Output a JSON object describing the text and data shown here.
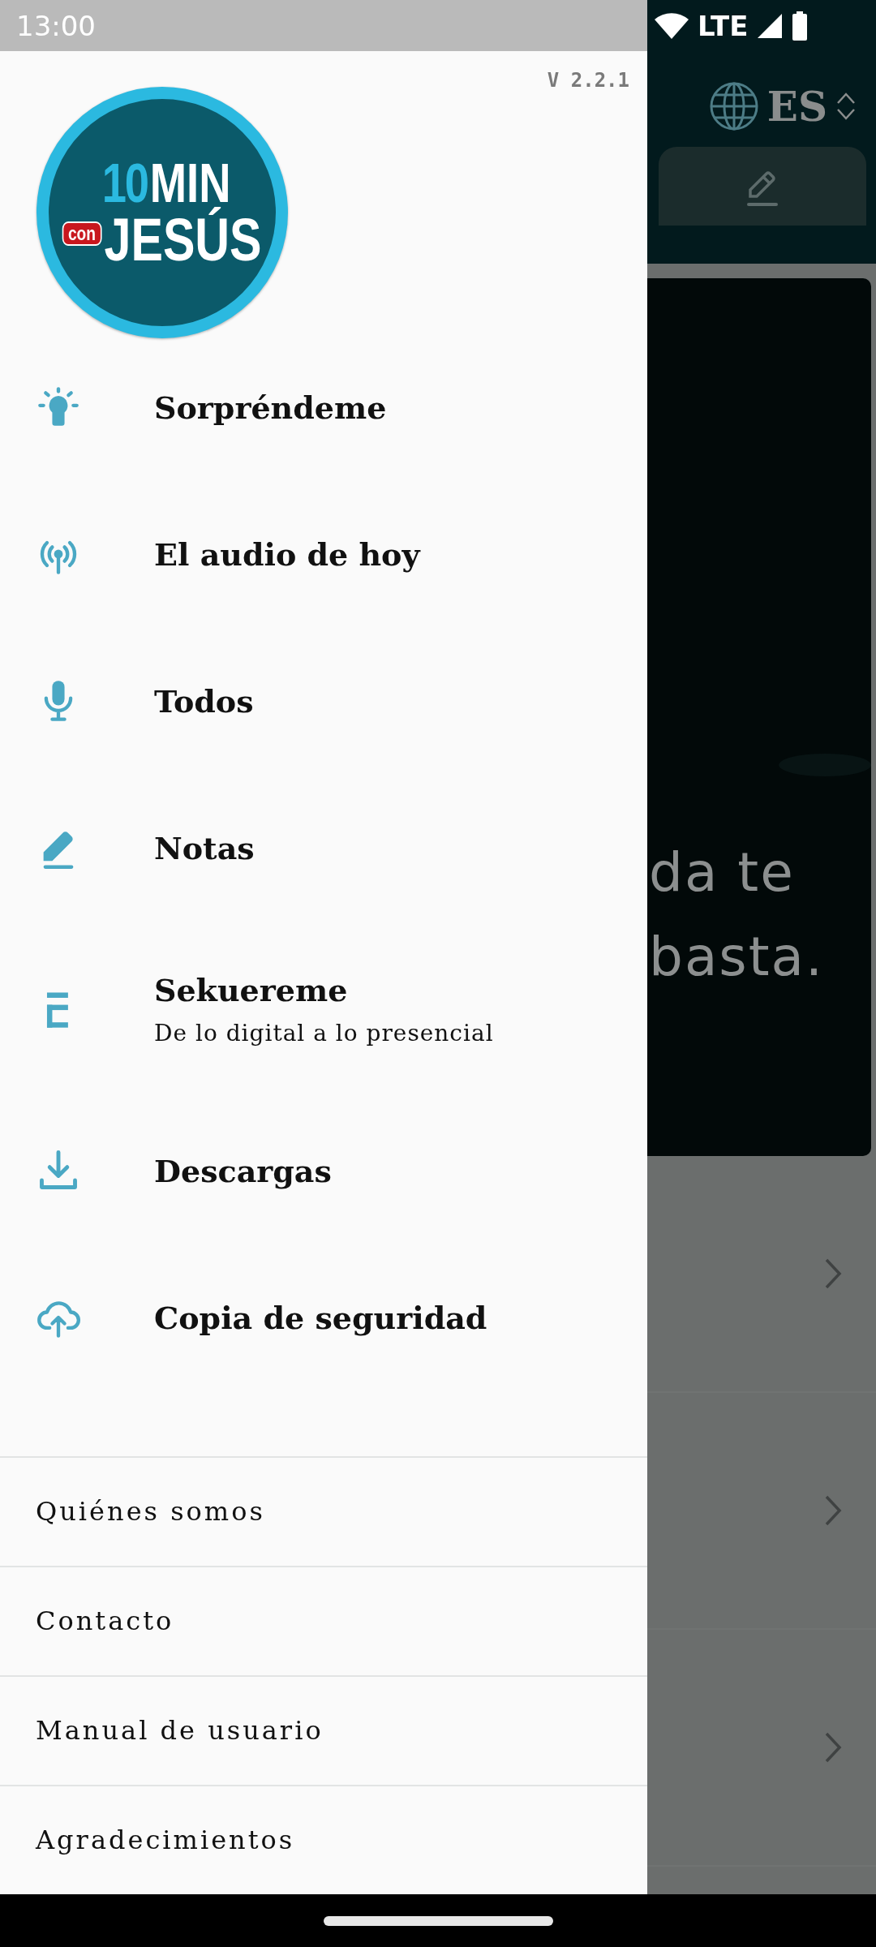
{
  "status_bar": {
    "time": "13:00",
    "network": "LTE"
  },
  "drawer": {
    "version": "V 2.2.1",
    "logo": {
      "number": "10",
      "word": "MIN",
      "badge": "con",
      "name": "JESÚS"
    },
    "menu": [
      {
        "label": "Sorpréndeme"
      },
      {
        "label": "El audio de hoy"
      },
      {
        "label": "Todos"
      },
      {
        "label": "Notas"
      },
      {
        "label": "Sekuereme",
        "subtitle": "De lo digital a lo presencial"
      },
      {
        "label": "Descargas"
      },
      {
        "label": "Copia de seguridad"
      }
    ],
    "links": [
      "Quiénes somos",
      "Contacto",
      "Manual de usuario",
      "Agradecimientos"
    ]
  },
  "background": {
    "language": "ES",
    "quote_lines": [
      "da te",
      "basta."
    ]
  }
}
